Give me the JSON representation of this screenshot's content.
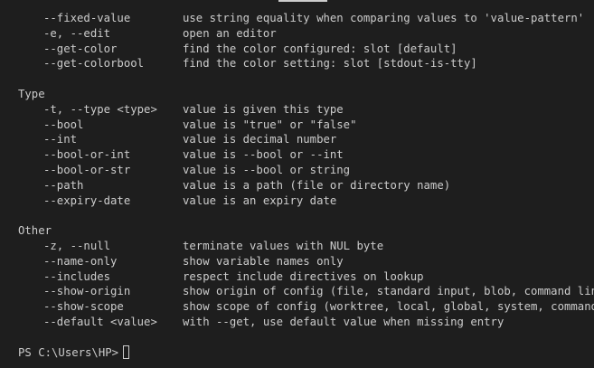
{
  "top_options": [
    {
      "option": "--fixed-value",
      "description": "use string equality when comparing values to 'value-pattern'"
    },
    {
      "option": "-e, --edit",
      "description": "open an editor"
    },
    {
      "option": "--get-color",
      "description": "find the color configured: slot [default]"
    },
    {
      "option": "--get-colorbool",
      "description": "find the color setting: slot [stdout-is-tty]"
    }
  ],
  "type_section": {
    "heading": "Type",
    "options": [
      {
        "option": "-t, --type <type>",
        "description": "value is given this type"
      },
      {
        "option": "--bool",
        "description": "value is \"true\" or \"false\""
      },
      {
        "option": "--int",
        "description": "value is decimal number"
      },
      {
        "option": "--bool-or-int",
        "description": "value is --bool or --int"
      },
      {
        "option": "--bool-or-str",
        "description": "value is --bool or string"
      },
      {
        "option": "--path",
        "description": "value is a path (file or directory name)"
      },
      {
        "option": "--expiry-date",
        "description": "value is an expiry date"
      }
    ]
  },
  "other_section": {
    "heading": "Other",
    "options": [
      {
        "option": "-z, --null",
        "description": "terminate values with NUL byte"
      },
      {
        "option": "--name-only",
        "description": "show variable names only"
      },
      {
        "option": "--includes",
        "description": "respect include directives on lookup"
      },
      {
        "option": "--show-origin",
        "description": "show origin of config (file, standard input, blob, command line)"
      },
      {
        "option": "--show-scope",
        "description": "show scope of config (worktree, local, global, system, command)"
      },
      {
        "option": "--default <value>",
        "description": "with --get, use default value when missing entry"
      }
    ]
  },
  "prompt": "PS C:\\Users\\HP>"
}
